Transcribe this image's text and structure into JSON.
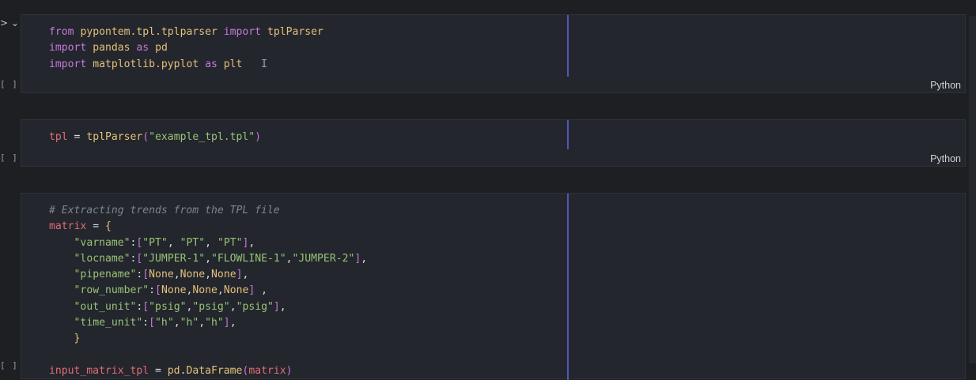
{
  "cells": [
    {
      "gutter": "[ ]",
      "language": "Python",
      "lines": [
        [
          [
            "kw",
            "from"
          ],
          [
            "plain",
            " "
          ],
          [
            "id",
            "pypontem.tpl.tplparser"
          ],
          [
            "plain",
            " "
          ],
          [
            "kw",
            "import"
          ],
          [
            "plain",
            " "
          ],
          [
            "id",
            "tplParser"
          ]
        ],
        [
          [
            "kw",
            "import"
          ],
          [
            "plain",
            " "
          ],
          [
            "id",
            "pandas"
          ],
          [
            "plain",
            " "
          ],
          [
            "kw",
            "as"
          ],
          [
            "plain",
            " "
          ],
          [
            "id",
            "pd"
          ]
        ],
        [
          [
            "kw",
            "import"
          ],
          [
            "plain",
            " "
          ],
          [
            "id",
            "matplotlib.pyplot"
          ],
          [
            "plain",
            " "
          ],
          [
            "kw",
            "as"
          ],
          [
            "plain",
            " "
          ],
          [
            "id",
            "plt"
          ],
          [
            "plain",
            "   "
          ],
          [
            "cursor",
            "I"
          ]
        ]
      ]
    },
    {
      "gutter": "[ ]",
      "language": "Python",
      "lines": [
        [
          [
            "var",
            "tpl"
          ],
          [
            "plain",
            " = "
          ],
          [
            "fn",
            "tplParser"
          ],
          [
            "br",
            "("
          ],
          [
            "str",
            "\"example_tpl.tpl\""
          ],
          [
            "br",
            ")"
          ]
        ]
      ]
    },
    {
      "gutter": "[ ]",
      "language": "",
      "lines": [
        [
          [
            "comment",
            "# Extracting trends from the TPL file"
          ]
        ],
        [
          [
            "var",
            "matrix"
          ],
          [
            "plain",
            " = "
          ],
          [
            "br2",
            "{"
          ]
        ],
        [
          [
            "plain",
            "    "
          ],
          [
            "str",
            "\"varname\""
          ],
          [
            "plain",
            ":"
          ],
          [
            "br",
            "["
          ],
          [
            "str",
            "\"PT\""
          ],
          [
            "plain",
            ", "
          ],
          [
            "str",
            "\"PT\""
          ],
          [
            "plain",
            ", "
          ],
          [
            "str",
            "\"PT\""
          ],
          [
            "br",
            "]"
          ],
          [
            "plain",
            ","
          ]
        ],
        [
          [
            "plain",
            "    "
          ],
          [
            "str",
            "\"locname\""
          ],
          [
            "plain",
            ":"
          ],
          [
            "br",
            "["
          ],
          [
            "str",
            "\"JUMPER-1\""
          ],
          [
            "plain",
            ","
          ],
          [
            "str",
            "\"FLOWLINE-1\""
          ],
          [
            "plain",
            ","
          ],
          [
            "str",
            "\"JUMPER-2\""
          ],
          [
            "br",
            "]"
          ],
          [
            "plain",
            ","
          ]
        ],
        [
          [
            "plain",
            "    "
          ],
          [
            "str",
            "\"pipename\""
          ],
          [
            "plain",
            ":"
          ],
          [
            "br",
            "["
          ],
          [
            "id",
            "None"
          ],
          [
            "plain",
            ","
          ],
          [
            "id",
            "None"
          ],
          [
            "plain",
            ","
          ],
          [
            "id",
            "None"
          ],
          [
            "br",
            "]"
          ],
          [
            "plain",
            ","
          ]
        ],
        [
          [
            "plain",
            "    "
          ],
          [
            "str",
            "\"row_number\""
          ],
          [
            "plain",
            ":"
          ],
          [
            "br",
            "["
          ],
          [
            "id",
            "None"
          ],
          [
            "plain",
            ","
          ],
          [
            "id",
            "None"
          ],
          [
            "plain",
            ","
          ],
          [
            "id",
            "None"
          ],
          [
            "br",
            "]"
          ],
          [
            "plain",
            " ,"
          ]
        ],
        [
          [
            "plain",
            "    "
          ],
          [
            "str",
            "\"out_unit\""
          ],
          [
            "plain",
            ":"
          ],
          [
            "br",
            "["
          ],
          [
            "str",
            "\"psig\""
          ],
          [
            "plain",
            ","
          ],
          [
            "str",
            "\"psig\""
          ],
          [
            "plain",
            ","
          ],
          [
            "str",
            "\"psig\""
          ],
          [
            "br",
            "]"
          ],
          [
            "plain",
            ","
          ]
        ],
        [
          [
            "plain",
            "    "
          ],
          [
            "str",
            "\"time_unit\""
          ],
          [
            "plain",
            ":"
          ],
          [
            "br",
            "["
          ],
          [
            "str",
            "\"h\""
          ],
          [
            "plain",
            ","
          ],
          [
            "str",
            "\"h\""
          ],
          [
            "plain",
            ","
          ],
          [
            "str",
            "\"h\""
          ],
          [
            "br",
            "]"
          ],
          [
            "plain",
            ","
          ]
        ],
        [
          [
            "plain",
            "    "
          ],
          [
            "br2",
            "}"
          ]
        ],
        [],
        [
          [
            "var",
            "input_matrix_tpl"
          ],
          [
            "plain",
            " = "
          ],
          [
            "id",
            "pd"
          ],
          [
            "plain",
            "."
          ],
          [
            "fn",
            "DataFrame"
          ],
          [
            "br",
            "("
          ],
          [
            "var",
            "matrix"
          ],
          [
            "br",
            ")"
          ]
        ]
      ]
    }
  ],
  "top_indicator": "> ⌄"
}
